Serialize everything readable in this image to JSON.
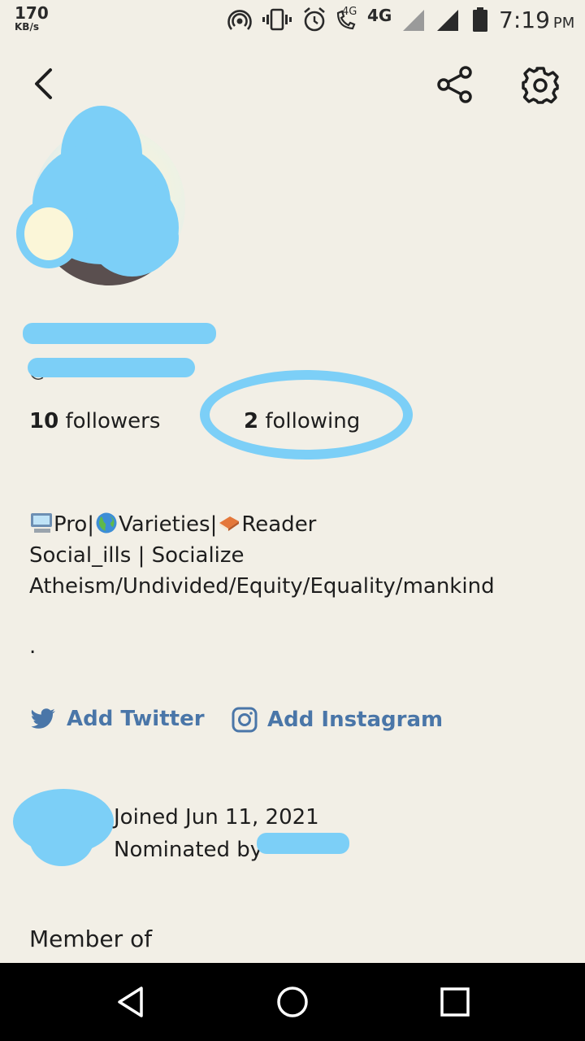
{
  "status_bar": {
    "speed_value": "170",
    "speed_unit": "KB/s",
    "network_small": "4G",
    "network": "4G",
    "time": "7:19",
    "ampm": "PM",
    "icons": [
      "hotspot-icon",
      "vibrate-icon",
      "alarm-icon",
      "volte-call-icon",
      "signal-icon",
      "signal-icon",
      "battery-icon"
    ]
  },
  "toolbar": {
    "back_icon": "back-arrow-icon",
    "share_icon": "share-icon",
    "settings_icon": "gear-icon"
  },
  "profile": {
    "username_prefix": "@",
    "followers_count": "10",
    "followers_label": " followers",
    "following_count": "2",
    "following_label": " following",
    "bio": {
      "line1_a": "Pro|",
      "line1_b": "Varieties|",
      "line1_c": "Reader",
      "line2": "Social_ills | Socialize",
      "line3": "Atheism/Undivided/Equity/Equality/mankind",
      "line4": "."
    },
    "add_twitter": "Add Twitter",
    "add_instagram": "Add Instagram",
    "joined": "Joined Jun 11, 2021",
    "nominated_by": "Nominated by",
    "member_of": "Member of"
  },
  "colors": {
    "background": "#f2efe6",
    "link": "#4a76a8",
    "redaction": "#7ccff7"
  },
  "nav": {
    "icons": [
      "nav-back-icon",
      "nav-home-icon",
      "nav-recents-icon"
    ]
  }
}
